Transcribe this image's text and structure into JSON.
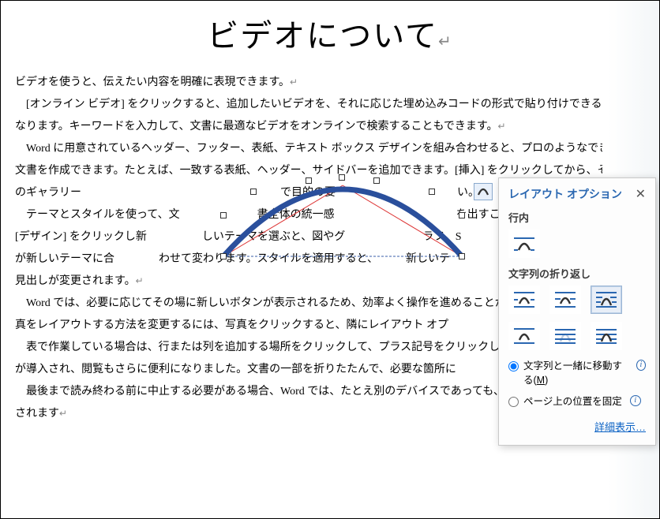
{
  "doc": {
    "title": "ビデオについて",
    "p1": "ビデオを使うと、伝えたい内容を明確に表現できます。",
    "p2": "[オンライン ビデオ] をクリックすると、追加したいビデオを、それに応じた埋め込みコードの形式で貼り付けできるようになります。キーワードを入力して、文書に最適なビデオをオンラインで検索することもできます。",
    "p3": "Word に用意されているヘッダー、フッター、表紙、テキスト ボックス デザインを組み合わせると、プロのようなできばえの文書を作成できます。たとえば、一致する表紙、ヘッダー、サイドバーを追加できます。[挿入] をクリックしてから、それぞれのギャラリー　　　　　　　　　　　　　　　　　　で目的の要　　　　　　　　　　　い。",
    "p4": "テーマとスタイルを使って、文　　　　　　　書全体の統一感　　　　　　　　　　　を出すこ　　　　　　　　　　　す。[デザイン] をクリックし新　　　　　しいテーマを選ぶと、図やグ　　　　　　　ラフ、S　　　　　　　　　　　ラフィックが新しいテーマに合　　　　わせて変わります。スタイルを適用すると、　　　新しいテ　　　　　　　　　　　合するように見出しが変更されます。",
    "p5": "Word では、必要に応じてその場に新しいボタンが表示されるため、効率よく操作を進めることが　　　　　　　文書内に写真をレイアウトする方法を変更するには、写真をクリックすると、隣にレイアウト オプ　　　　　　タンが表示されます。",
    "p6": "表で作業している場合は、行または列を追加する場所をクリックして、プラス記号をクリックしま　　　　　　　閲覧ビューが導入され、閲覧もさらに便利になりました。文書の一部を折りたたんで、必要な箇所に　　　　　　とができます。",
    "p7": "最後まで読み終わる前に中止する必要がある場合、Word では、たとえ別のデバイスであっても、　　　　　　　んだかが記憶されます",
    "shape_text_mid": "書全体の統一感"
  },
  "popup": {
    "title": "レイアウト オプション",
    "section_inline": "行内",
    "section_wrap": "文字列の折り返し",
    "radio_move": "文字列と一緒に移動する(",
    "radio_move_key": "M",
    "radio_move_tail": ")",
    "radio_fix": "ページ上の位置を固定",
    "detail_link": "詳細表示…"
  },
  "icons": {
    "close": "✕",
    "info": "i"
  }
}
